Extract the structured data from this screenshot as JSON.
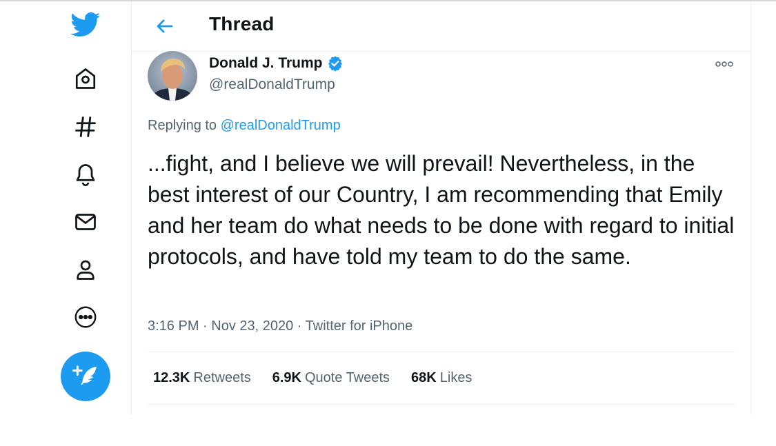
{
  "header": {
    "title": "Thread",
    "back_icon": "arrow-left-icon"
  },
  "sidebar": {
    "items": [
      {
        "icon": "twitter-bird-icon"
      },
      {
        "icon": "home-icon"
      },
      {
        "icon": "hashtag-icon"
      },
      {
        "icon": "bell-icon"
      },
      {
        "icon": "envelope-icon"
      },
      {
        "icon": "person-icon"
      },
      {
        "icon": "more-circle-icon"
      }
    ],
    "compose_icon": "feather-plus-icon"
  },
  "tweet": {
    "author_name": "Donald J. Trump",
    "author_handle": "@realDonaldTrump",
    "verified": true,
    "replying_prefix": "Replying to",
    "replying_to": "@realDonaldTrump",
    "text": "...fight, and I believe we will prevail! Nevertheless, in the best interest of our Country, I am recommending that Emily and her team do what needs to be done with regard to initial protocols, and have told my team to do the same.",
    "meta": "3:16 PM · Nov 23, 2020 · Twitter for iPhone",
    "stats": [
      {
        "value": "12.3K",
        "label": "Retweets"
      },
      {
        "value": "6.9K",
        "label": "Quote Tweets"
      },
      {
        "value": "68K",
        "label": "Likes"
      }
    ]
  },
  "colors": {
    "accent": "#1d9bf0",
    "text": "#0f1419",
    "muted": "#536471",
    "border": "#eff3f4"
  }
}
